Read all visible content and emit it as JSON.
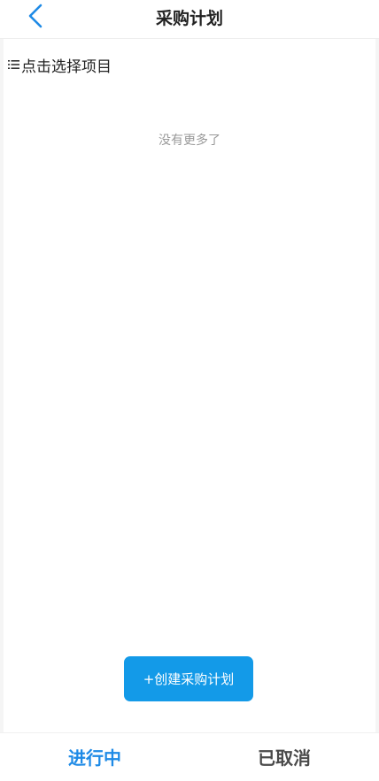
{
  "nav": {
    "title": "采购计划",
    "back_icon": "chevron-left-icon"
  },
  "filter": {
    "icon": "list-icon",
    "label": "点击选择项目"
  },
  "list": {
    "empty_text": "没有更多了"
  },
  "actions": {
    "create_label": "+创建采购计划"
  },
  "tabs": [
    {
      "label": "进行中",
      "active": true
    },
    {
      "label": "已取消",
      "active": false
    }
  ],
  "colors": {
    "accent": "#1e8ae6",
    "button": "#139ae8",
    "text": "#222222",
    "muted": "#999999"
  }
}
